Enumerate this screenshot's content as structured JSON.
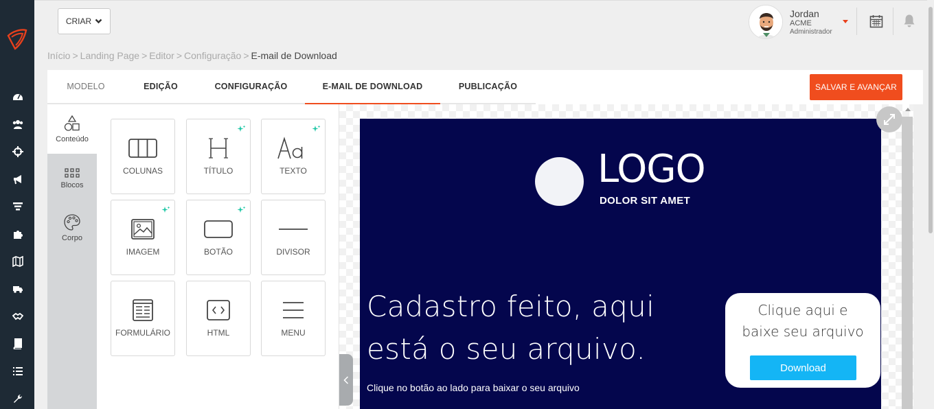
{
  "header": {
    "create_button": "CRIAR",
    "user": {
      "name": "Jordan",
      "company": "ACME",
      "role": "Administrador"
    }
  },
  "breadcrumb": {
    "items": [
      "Início",
      "Landing Page",
      "Editor",
      "Configuração"
    ],
    "separator": ">",
    "current": "E-mail de Download"
  },
  "tabs": [
    {
      "label": "MODELO",
      "state": "done"
    },
    {
      "label": "EDIÇÃO",
      "state": "normal"
    },
    {
      "label": "CONFIGURAÇÃO",
      "state": "normal"
    },
    {
      "label": "E-MAIL DE DOWNLOAD",
      "state": "active"
    },
    {
      "label": "PUBLICAÇÃO",
      "state": "normal"
    }
  ],
  "save_button": "SALVAR E AVANÇAR",
  "editor_nav": [
    {
      "label": "Conteúdo",
      "icon": "shapes-icon",
      "active": true
    },
    {
      "label": "Blocos",
      "icon": "grid-dots-icon",
      "active": false
    },
    {
      "label": "Corpo",
      "icon": "palette-icon",
      "active": false
    }
  ],
  "content_tiles": [
    {
      "label": "COLUNAS",
      "icon": "columns-icon",
      "sparkle": false
    },
    {
      "label": "TÍTULO",
      "icon": "heading-icon",
      "sparkle": true
    },
    {
      "label": "TEXTO",
      "icon": "text-icon",
      "sparkle": true
    },
    {
      "label": "IMAGEM",
      "icon": "image-icon",
      "sparkle": true
    },
    {
      "label": "BOTÃO",
      "icon": "button-icon",
      "sparkle": true
    },
    {
      "label": "DIVISOR",
      "icon": "divider-icon",
      "sparkle": false
    },
    {
      "label": "FORMULÁRIO",
      "icon": "form-icon",
      "sparkle": false
    },
    {
      "label": "HTML",
      "icon": "code-icon",
      "sparkle": false
    },
    {
      "label": "MENU",
      "icon": "menu-icon",
      "sparkle": false
    }
  ],
  "email_preview": {
    "logo_word": "LOGO",
    "logo_tagline": "DOLOR SIT AMET",
    "headline_line1": "Cadastro feito, aqui",
    "headline_line2": "está o seu arquivo.",
    "subtext": "Clique no botão ao lado para baixar o seu arquivo",
    "cta_line1": "Clique aqui e",
    "cta_line2": "baixe seu arquivo",
    "download_button": "Download",
    "colors": {
      "background": "#04064d",
      "button": "#14b5f5"
    }
  },
  "colors": {
    "accent": "#f04d1e",
    "sidebar": "#1e2a35",
    "sparkle": "#1fc7a6"
  }
}
